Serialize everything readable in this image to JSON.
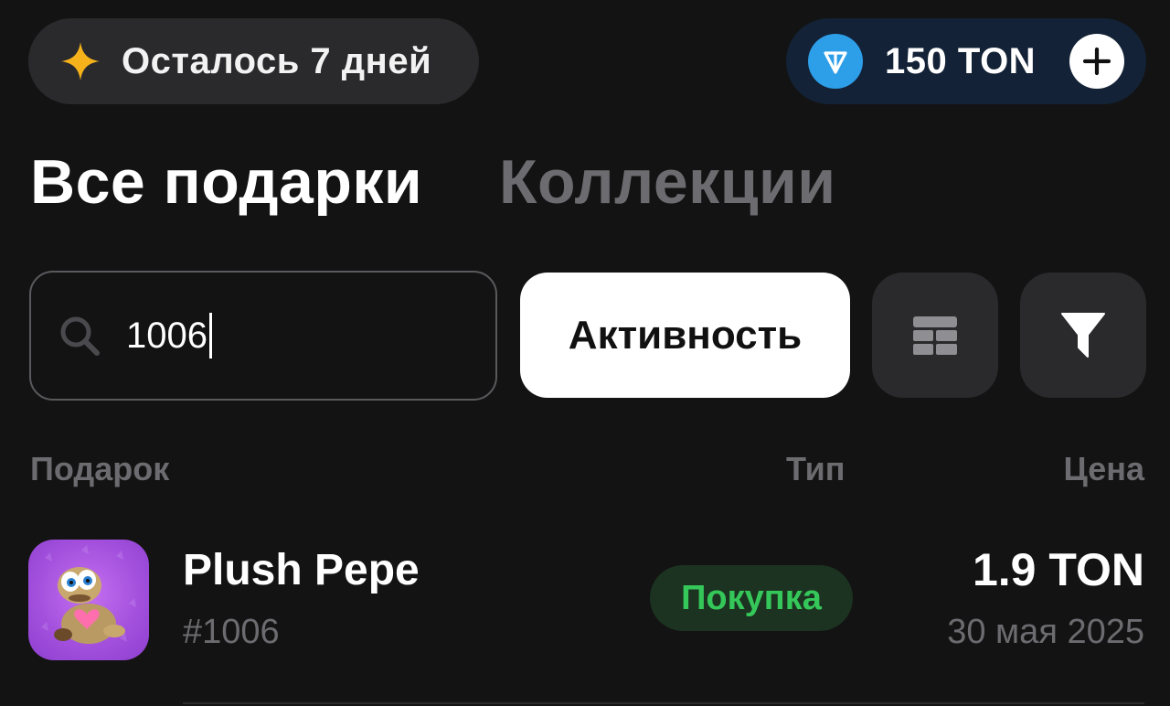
{
  "header": {
    "days_left_label": "Осталось 7 дней",
    "balance_label": "150 TON",
    "icons": {
      "star": "sparkle-star-icon",
      "ton": "ton-coin-icon",
      "plus": "plus-icon"
    },
    "colors": {
      "star": "#f5b21b",
      "ton": "#2d9ee8",
      "balance_pill": "#132236"
    }
  },
  "tabs": [
    {
      "label": "Все подарки",
      "active": true
    },
    {
      "label": "Коллекции",
      "active": false
    }
  ],
  "search": {
    "value": "1006",
    "icon": "search-icon"
  },
  "toolbar": {
    "activity_label": "Активность",
    "grid_icon": "table-grid-icon",
    "filter_icon": "filter-icon"
  },
  "columns": {
    "gift": "Подарок",
    "type": "Тип",
    "price": "Цена"
  },
  "rows": [
    {
      "name": "Plush Pepe",
      "id": "#1006",
      "type": "Покупка",
      "price": "1.9 TON",
      "date": "30 мая 2025",
      "colors": {
        "type_text": "#35c759",
        "type_bg": "#1b3320",
        "thumb_bg": "#a14fdc"
      }
    }
  ]
}
